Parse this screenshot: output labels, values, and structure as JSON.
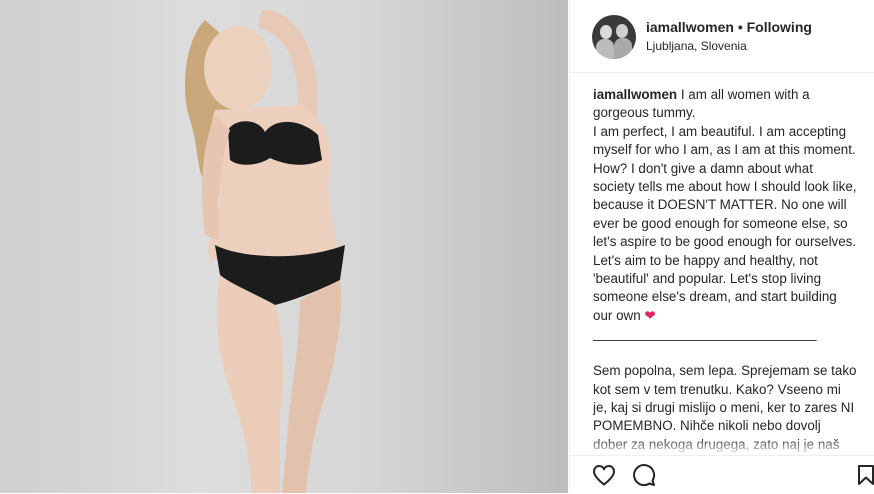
{
  "post": {
    "username": "iamallwomen",
    "separator": "•",
    "follow_status": "Following",
    "location": "Ljubljana, Slovenia",
    "caption": {
      "username": "iamallwomen",
      "english": "I am all women with a gorgeous tummy.\nI am perfect, I am beautiful. I am accepting myself for who I am, as I am at this moment. How? I don't give a damn about what society tells me about how I should look like, because it DOESN'T MATTER. No one will ever be good enough for someone else, so let's aspire to be good enough for ourselves. Let's aim to be happy and healthy, not 'beautiful' and popular. Let's stop living someone else's dream, and start building our own ",
      "heart": "❤",
      "divider": "\n______________________________\n\n",
      "slovene": "Sem popolna, sem lepa. Sprejemam se tako kot sem v tem trenutku. Kako? Vseeno mi je, kaj si drugi mislijo o meni, ker to zares NI POMEMBNO. Nihče nikoli nebo dovolj dober za nekoga drugega, zato naj je naš cilj, da smo dovolj dobri sami sebi. Naj bo naš"
    }
  },
  "icons": {
    "like": "heart-outline-icon",
    "comment": "comment-bubble-icon",
    "save": "bookmark-icon"
  },
  "colors": {
    "heart": "#e0245e",
    "text": "#262626",
    "border": "#efefef"
  }
}
